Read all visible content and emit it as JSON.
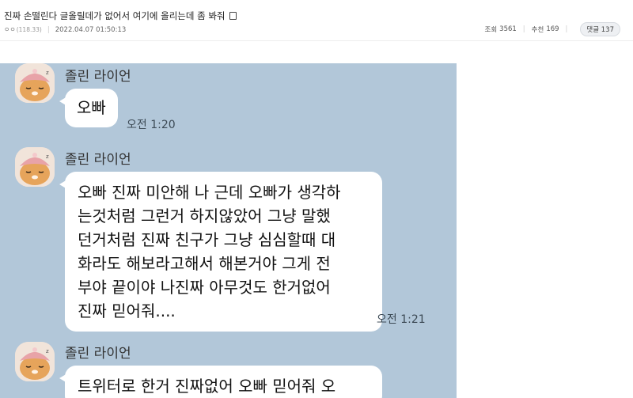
{
  "post": {
    "title": "진짜 손떨린다 글올릴데가 없어서 여기에 올리는데 좀 봐줘",
    "author_marks": "ㅇㅇ",
    "author_ip": "(118.33)",
    "date": "2022.04.07 01:50:13",
    "views_label": "조회",
    "views": "3561",
    "likes_label": "추천",
    "likes": "169",
    "comments_label": "댓글",
    "comments": "137"
  },
  "chat": {
    "messages": [
      {
        "sender": "졸린 라이언",
        "lines": [
          "오빠"
        ],
        "time": "오전 1:20"
      },
      {
        "sender": "졸린 라이언",
        "lines": [
          "오빠 진짜 미안해 나 근데 오빠가 생각하",
          "는것처럼 그런거 하지않았어 그냥 말했",
          "던거처럼 진짜 친구가 그냥 심심할때 대",
          "화라도 해보라고해서 해본거야 그게 전",
          "부야 끝이야 나진짜 아무것도 한거없어",
          "진짜 믿어줘...."
        ],
        "time": "오전 1:21"
      },
      {
        "sender": "졸린 라이언",
        "lines": [
          "트위터로 한거 진짜없어 오빠 믿어줘 오"
        ],
        "time": ""
      }
    ],
    "colors": {
      "background": "#b2c7d9",
      "bubble": "#ffffff"
    },
    "avatar_icon": "sleepy-ryan-character-icon"
  }
}
